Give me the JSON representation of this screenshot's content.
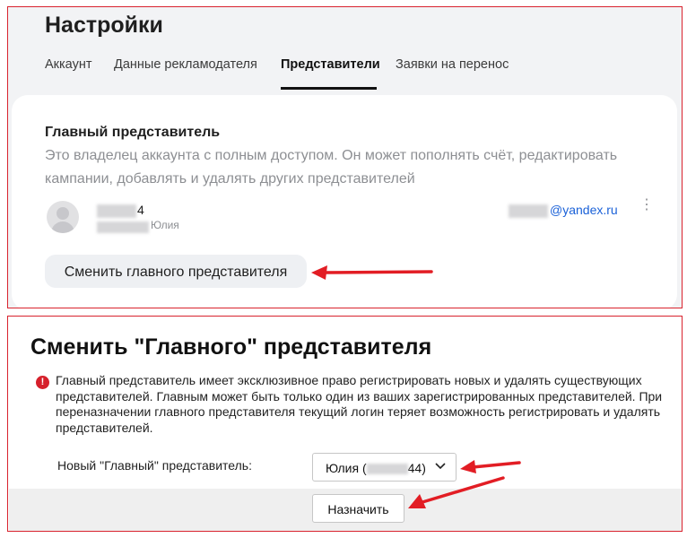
{
  "settings": {
    "title": "Настройки",
    "tabs": [
      {
        "label": "Аккаунт"
      },
      {
        "label": "Данные рекламодателя"
      },
      {
        "label": "Представители",
        "active": true
      },
      {
        "label": "Заявки на перенос"
      }
    ],
    "main_rep": {
      "title": "Главный представитель",
      "description": "Это владелец аккаунта с полным доступом. Он может пополнять счёт, редактировать кампании, добавлять и удалять других представителей",
      "user": {
        "login_visible": "4",
        "name": "Юлия",
        "email_visible": "@yandex.ru"
      },
      "more_icon": "vertical-ellipsis-icon",
      "change_button": "Сменить главного представителя"
    }
  },
  "dialog": {
    "title": "Сменить \"Главного\" представителя",
    "warning_icon": "exclamation-circle-icon",
    "warning_text": "Главный представитель имеет эксклюзивное право регистрировать новых и удалять существующих представителей. Главным может быть только один из ваших зарегистрированных представителей. При переназначении главного представителя текущий логин теряет возможность регистрировать и удалять представителей.",
    "field_label": "Новый \"Главный\" представитель:",
    "select_prefix": "Юлия (",
    "select_suffix": "44)",
    "assign_button": "Назначить"
  },
  "colors": {
    "annotation_red": "#e21d24",
    "link_blue": "#1a61d8",
    "warning_red": "#d6202b"
  }
}
